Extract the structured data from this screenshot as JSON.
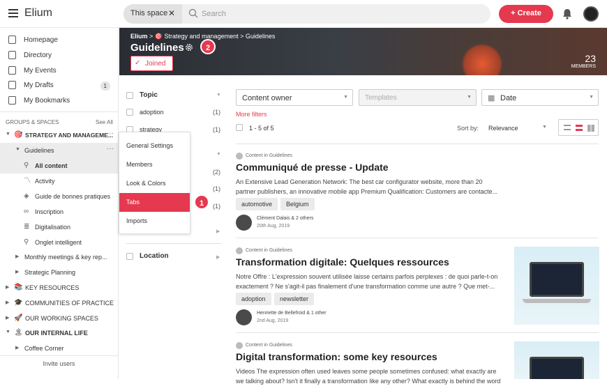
{
  "topbar": {
    "app_name": "Elium",
    "scope_label": "This space",
    "scope_clear": "✕",
    "search_placeholder": "Search",
    "create_label": "+ Create"
  },
  "sidebar": {
    "nav": [
      {
        "label": "Homepage",
        "icon": "home-icon"
      },
      {
        "label": "Directory",
        "icon": "directory-icon"
      },
      {
        "label": "My Events",
        "icon": "calendar-icon"
      },
      {
        "label": "My Drafts",
        "icon": "drafts-icon",
        "badge": "1"
      },
      {
        "label": "My Bookmarks",
        "icon": "bookmark-icon"
      }
    ],
    "groups_label": "GROUPS & SPACES",
    "see_all": "See All",
    "tree": [
      {
        "label": "STRATEGY AND MANAGEME...",
        "icon": "🎯"
      },
      {
        "label": "Guidelines"
      },
      {
        "label": "All content"
      },
      {
        "label": "Activity"
      },
      {
        "label": "Guide de bonnes pratiques"
      },
      {
        "label": "Inscription"
      },
      {
        "label": "Digitalisation"
      },
      {
        "label": "Onglet intelligent"
      },
      {
        "label": "Monthly meetings & key rep..."
      },
      {
        "label": "Strategic Planning"
      },
      {
        "label": "KEY RESOURCES",
        "icon": "📚"
      },
      {
        "label": "COMMUNITIES OF PRACTICE",
        "icon": "🎓"
      },
      {
        "label": "OUR WORKING SPACES",
        "icon": "🚀"
      },
      {
        "label": "OUR INTERNAL LIFE",
        "icon": "🏝"
      },
      {
        "label": "Coffee Corner"
      }
    ],
    "invite": "Invite users"
  },
  "banner": {
    "crumb_root": "Elium",
    "crumb_sep": ">",
    "crumb_mid": "🎯 Strategy and management",
    "crumb_leaf": "Guidelines",
    "title": "Guidelines",
    "joined": "Joined",
    "members_count": "23",
    "members_label": "MEMBERS",
    "step1": "1",
    "step2": "2"
  },
  "filters": {
    "topic": "Topic",
    "topic_items": [
      {
        "label": "adoption",
        "count": "(1)"
      },
      {
        "label": "strategy",
        "count": "(1)"
      }
    ],
    "hidden_counts": [
      "(2)",
      "(1)",
      "(1)"
    ],
    "location": "Location"
  },
  "menu": {
    "items": [
      "General Settings",
      "Members",
      "Look & Colors",
      "Tabs",
      "Imports"
    ],
    "active": "Tabs"
  },
  "main": {
    "content_owner": "Content owner",
    "templates": "Templates",
    "date": "Date",
    "more_filters": "More filters",
    "result_count": "1 - 5 of 5",
    "sort_by": "Sort by:",
    "sort_value": "Relevance",
    "cards": [
      {
        "source": "Content in Guidelines",
        "title": "Communiqué de presse - Update",
        "desc1": "An Extensive Lead Generation Network: The best car configurator website, more than 20",
        "desc2": "partner publishers, an innovative mobile app Premium Qualification: Customers are contacte...",
        "tags": [
          "automotive",
          "Belgium"
        ],
        "author": "Clément Dalais & 2 others",
        "date": "20th Aug, 2019"
      },
      {
        "source": "Content in Guidelines",
        "title": "Transformation digitale: Quelques ressources",
        "desc1": "Notre Offre : L'expression souvent utilisée laisse certains parfois perplexes : de quoi parle-t-on",
        "desc2": "exactement ? Ne s'agit-il pas finalement d'une transformation comme une autre ? Que met-...",
        "tags": [
          "adoption",
          "newsletter"
        ],
        "author": "Henriette de Bellefroid & 1 other",
        "date": "2nd Aug, 2019"
      },
      {
        "source": "Content in Guidelines",
        "title": "Digital transformation: some key resources",
        "desc1": "Videos The expression often used leaves some people sometimes confused: what exactly are",
        "desc2": "we talking about? Isn't it finally a transformation like any other? What exactly is behind the word"
      }
    ]
  },
  "colors": {
    "accent": "#e53950"
  }
}
